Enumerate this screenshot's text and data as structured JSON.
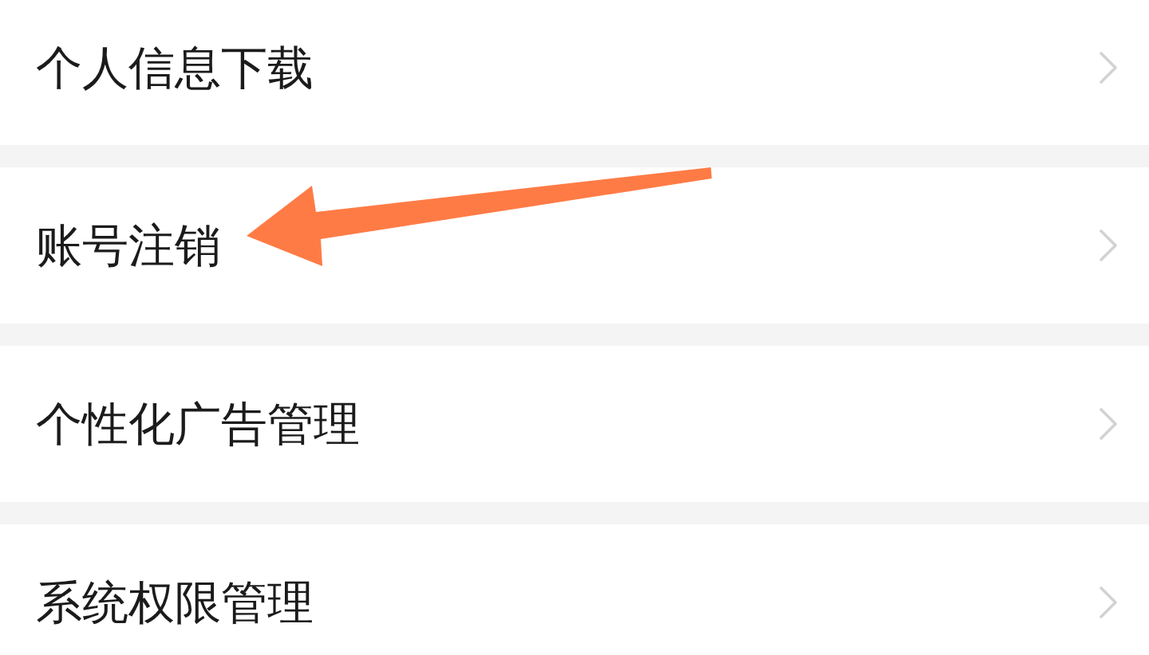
{
  "settings_list": {
    "items": [
      {
        "label": "个人信息下载",
        "pointed_at": false
      },
      {
        "label": "账号注销",
        "pointed_at": true
      },
      {
        "label": "个性化广告管理",
        "pointed_at": false
      },
      {
        "label": "系统权限管理",
        "pointed_at": false
      }
    ]
  }
}
